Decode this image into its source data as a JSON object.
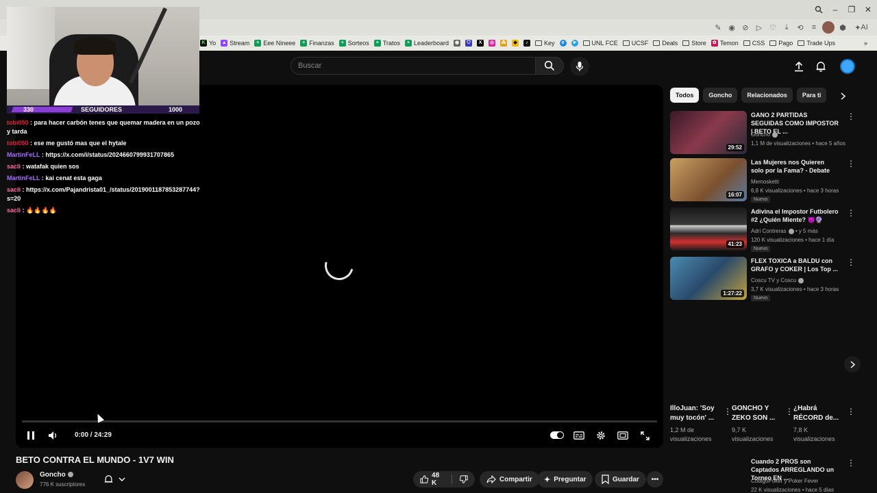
{
  "browser": {
    "bookmarks": [
      {
        "label": "Yo",
        "icon": "kick-icon",
        "color": "#53fc18"
      },
      {
        "label": "Stream",
        "icon": "stream-icon",
        "color": "#9147ff"
      },
      {
        "label": "Eee Nineee",
        "icon": "sheets-icon",
        "color": "#0f9d58"
      },
      {
        "label": "Finanzas",
        "icon": "sheets-icon",
        "color": "#0f9d58"
      },
      {
        "label": "Sorteos",
        "icon": "sheets-icon",
        "color": "#0f9d58"
      },
      {
        "label": "Tratos",
        "icon": "sheets-icon",
        "color": "#0f9d58"
      },
      {
        "label": "Leaderboard",
        "icon": "sheets-icon",
        "color": "#0f9d58"
      }
    ],
    "bookmarks2": [
      {
        "label": "Key",
        "icon": "folder-icon"
      },
      {
        "label": "UNL FCE",
        "icon": "folder-icon"
      },
      {
        "label": "UCSF",
        "icon": "folder-icon"
      },
      {
        "label": "Deals",
        "icon": "folder-icon"
      },
      {
        "label": "Store",
        "icon": "folder-icon"
      },
      {
        "label": "Temon",
        "icon": "temon-icon"
      },
      {
        "label": "CSS",
        "icon": "folder-icon"
      },
      {
        "label": "Pago",
        "icon": "folder-icon"
      },
      {
        "label": "Trade Ups",
        "icon": "folder-icon"
      }
    ],
    "ai_label": "AI"
  },
  "youtube": {
    "search_placeholder": "Buscar"
  },
  "webcam": {
    "left_number": "330",
    "center_label": "SEGUIDORES",
    "right_number": "1000",
    "progress": 0.33
  },
  "chat": [
    {
      "user": "tobi050",
      "color": "red",
      "text": " : para hacer carbón tenes que quemar madera en un pozo y tarda"
    },
    {
      "user": "tobi050",
      "color": "red",
      "text": " : ese me gustó mas que el hytale"
    },
    {
      "user": "MartinFeLL",
      "color": "purple",
      "text": " : https://x.com/i/status/2024660799931707865"
    },
    {
      "user": "sacli",
      "color": "pink",
      "text": " : watafak quien sos"
    },
    {
      "user": "MartinFeLL",
      "color": "purple",
      "text": " : kai cenat esta gaga"
    },
    {
      "user": "sacli",
      "color": "pink",
      "text": " : https://x.com/Pajandrista01_/status/2019001187853287744?s=20"
    },
    {
      "user": "sacli",
      "color": "pink",
      "text": " : 🔥🔥🔥🔥"
    }
  ],
  "player": {
    "time": "0:00 / 24:29"
  },
  "video": {
    "title": "BETO CONTRA EL MUNDO - 1V7 WIN",
    "channel": "Goncho",
    "subscribers": "776 K suscriptores",
    "likes": "48 K",
    "share": "Compartir",
    "ask": "Preguntar",
    "save": "Guardar"
  },
  "chips": [
    "Todos",
    "Goncho",
    "Relacionados",
    "Para ti"
  ],
  "recommendations": [
    {
      "title": "GANO 2 PARTIDAS SEGUIDAS COMO IMPOSTOR | BETO EL ...",
      "channel": "Goncho",
      "verified": true,
      "meta": "1,1 M de visualizaciones • hace 5 años",
      "duration": "29:52",
      "new": "",
      "thumb_color": "#5a2a3a"
    },
    {
      "title": "Las Mujeres nos Quieren solo por la Fama? - Debate",
      "channel": "Memosketti",
      "verified": false,
      "meta": "6,8 K visualizaciones • hace 3 horas",
      "duration": "16:07",
      "new": "Nuevo",
      "thumb_color": "#b98a4a"
    },
    {
      "title": "Adivina el Impostor Futbolero #2 ¿Quién Miente? 😈🔮",
      "channel": "Adri Contreras",
      "verified": true,
      "channel_extra": "• y 5 más",
      "meta": "120 K visualizaciones • hace 1 día",
      "duration": "41:23",
      "new": "Nuevo",
      "thumb_color": "#2a2a2a"
    },
    {
      "title": "FLEX TOXICA a BALDU con GRAFO y COKER | Los Top ...",
      "channel": "Coscu TV y Coscu",
      "verified": true,
      "meta": "3,7 K visualizaciones • hace 3 horas",
      "duration": "1:27:22",
      "new": "Nuevo",
      "thumb_color": "#3a6a8a"
    }
  ],
  "shorts": [
    {
      "title": "IlloJuan: 'Soy muy tocón' ...",
      "views": "1,2 M de visualizaciones"
    },
    {
      "title": "GONCHO Y ZEKO SON ...",
      "views": "9,7 K visualizaciones"
    },
    {
      "title": "¿Habrá RÉCORD de...",
      "views": "7,8 K visualizaciones"
    }
  ],
  "bottom_rec": {
    "title": "Cuando 2 PROS son Captados ARREGLANDO un Torneo EN ...",
    "channel": "CodigoPoker y Poker Fever",
    "meta": "22 K visualizaciones • hace 5 días"
  }
}
